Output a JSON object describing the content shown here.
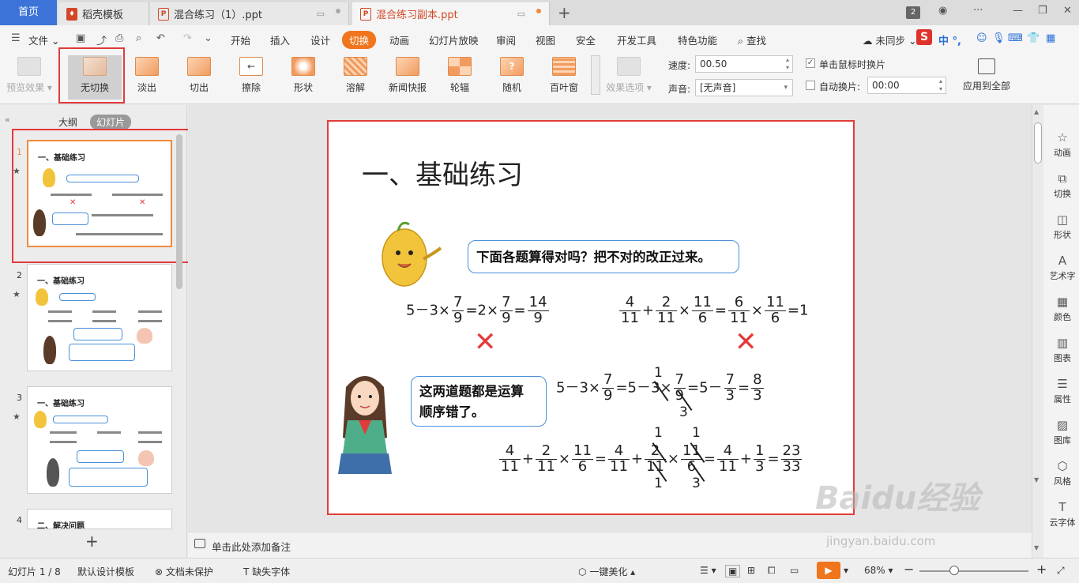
{
  "tabs": {
    "home": "首页",
    "items": [
      {
        "label": "稻壳模板"
      },
      {
        "label": "混合练习（1）.ppt"
      },
      {
        "label": "混合练习副本.ppt"
      }
    ],
    "badge": "2"
  },
  "menubar": {
    "file": "文件",
    "items": [
      "开始",
      "插入",
      "设计",
      "切换",
      "动画",
      "幻灯片放映",
      "审阅",
      "视图",
      "安全",
      "开发工具",
      "特色功能"
    ],
    "active": "切换",
    "search": "查找",
    "sync": "未同步"
  },
  "ribbon": {
    "preview": "预览效果",
    "transitions": [
      "无切换",
      "淡出",
      "切出",
      "擦除",
      "形状",
      "溶解",
      "新闻快报",
      "轮辐",
      "随机",
      "百叶窗"
    ],
    "effect_options": "效果选项",
    "speed_label": "速度:",
    "speed_value": "00.50",
    "sound_label": "声音:",
    "sound_value": "[无声音]",
    "on_click": "单击鼠标时换片",
    "on_click_checked": true,
    "auto_label": "自动换片:",
    "auto_value": "00:00",
    "apply_all": "应用到全部"
  },
  "left_panel": {
    "outline_tab": "大纲",
    "slides_tab": "幻灯片",
    "thumbnails": [
      {
        "num": "1",
        "title": "一、基础练习"
      },
      {
        "num": "2",
        "title": "一、基础练习"
      },
      {
        "num": "3",
        "title": "一、基础练习"
      },
      {
        "num": "4",
        "title": "二、解决问题"
      }
    ]
  },
  "slide": {
    "title": "一、基础练习",
    "bubble1": "下面各题算得对吗？把不对的改正过来。",
    "bubble2_line1": "这两道题都是运算",
    "bubble2_line2": "顺序错了。",
    "eq1": {
      "a": "5－3×",
      "f1n": "7",
      "f1d": "9",
      "b": "=2×",
      "f2n": "7",
      "f2d": "9",
      "c": "=",
      "f3n": "14",
      "f3d": "9"
    },
    "eq2": {
      "f1n": "4",
      "f1d": "11",
      "plus": "+",
      "f2n": "2",
      "f2d": "11",
      "times": "×",
      "f3n": "11",
      "f3d": "6",
      "eq": "=",
      "f4n": "6",
      "f4d": "11",
      "times2": "×",
      "f5n": "11",
      "f5d": "6",
      "res": "=1"
    },
    "eq3": {
      "a": "5－3×",
      "f1n": "7",
      "f1d": "9",
      "b": "=5－3×",
      "f2n": "7",
      "f2d": "9",
      "c": "=5－",
      "f3n": "7",
      "f3d": "3",
      "d": "=",
      "f4n": "8",
      "f4d": "3",
      "cancel_top": "1",
      "cancel_bottom": "3"
    },
    "eq4": {
      "f1n": "4",
      "f1d": "11",
      "plus": "+",
      "f2n": "2",
      "f2d": "11",
      "times": "×",
      "f3n": "11",
      "f3d": "6",
      "eq": "=",
      "f4n": "4",
      "f4d": "11",
      "plus2": "+",
      "f5n": "2",
      "f5d": "11",
      "times2": "×",
      "f6n": "11",
      "f6d": "6",
      "eq2": "=",
      "f7n": "4",
      "f7d": "11",
      "plus3": "+",
      "f8n": "1",
      "f8d": "3",
      "eq3": "=",
      "f9n": "23",
      "f9d": "33",
      "c1": "1",
      "c2": "1",
      "c3": "1",
      "c4": "3"
    }
  },
  "right_panel": {
    "items": [
      "动画",
      "切换",
      "形状",
      "艺术字",
      "颜色",
      "图表",
      "属性",
      "图库",
      "风格",
      "云字体"
    ]
  },
  "notes": {
    "placeholder": "单击此处添加备注"
  },
  "statusbar": {
    "slide_info": "幻灯片 1 / 8",
    "theme": "默认设计模板",
    "protect": "文档未保护",
    "font_missing": "缺失字体",
    "beautify": "一键美化",
    "zoom": "68%"
  },
  "watermark": {
    "brand": "Baidu经验",
    "url": "jingyan.baidu.com"
  },
  "colors": {
    "accent": "#f0751c",
    "home_tab": "#3c73d8",
    "highlight": "#e23b3b"
  }
}
